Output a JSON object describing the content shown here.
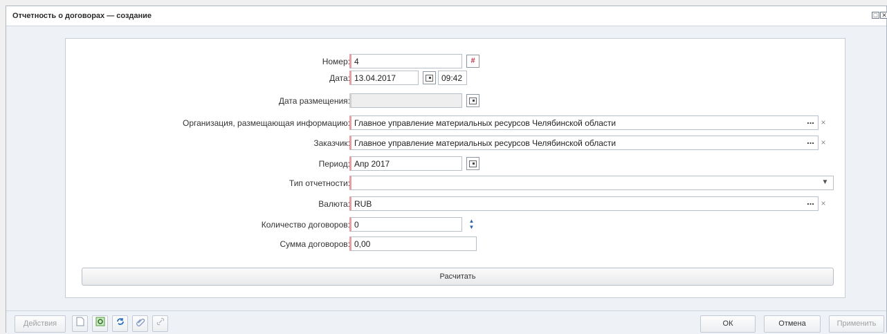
{
  "window": {
    "title": "Отчетность о договорах — создание",
    "maximize_glyph": "□",
    "close_glyph": "✕"
  },
  "form": {
    "number": {
      "label": "Номер:",
      "value": "4",
      "button_glyph": "#"
    },
    "date": {
      "label": "Дата:",
      "value": "13.04.2017",
      "time": "09:42"
    },
    "placement_date": {
      "label": "Дата размещения:",
      "value": ""
    },
    "organization": {
      "label": "Организация, размещающая информацию:",
      "value": "Главное управление материальных ресурсов Челябинской области"
    },
    "customer": {
      "label": "Заказчик:",
      "value": "Главное управление материальных ресурсов Челябинской области"
    },
    "period": {
      "label": "Период:",
      "value": "Апр 2017"
    },
    "report_type": {
      "label": "Тип отчетности:",
      "value": ""
    },
    "currency": {
      "label": "Валюта:",
      "value": "RUB"
    },
    "contracts_count": {
      "label": "Количество договоров:",
      "value": "0"
    },
    "contracts_sum": {
      "label": "Сумма договоров:",
      "value": "0,00"
    },
    "ellipsis_glyph": "...",
    "clear_glyph": "×",
    "dropdown_glyph": "▼",
    "spin_up_glyph": "▲",
    "spin_down_glyph": "▼",
    "calculate_label": "Расчитать"
  },
  "footer": {
    "actions_label": "Действия",
    "ok_label": "ОК",
    "cancel_label": "Отмена",
    "apply_label": "Применить",
    "icons": [
      "document-icon",
      "refresh-green-icon",
      "refresh-blue-icon",
      "attach-icon",
      "link-icon"
    ]
  }
}
